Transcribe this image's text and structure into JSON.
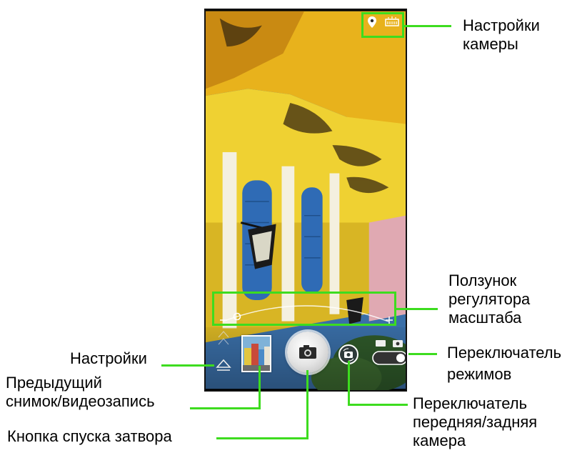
{
  "callouts": {
    "camera_settings": [
      "Настройки",
      "камеры"
    ],
    "zoom_slider": [
      "Ползунок",
      "регулятора",
      "масштаба"
    ],
    "mode_switch": [
      "Переключатель",
      "режимов"
    ],
    "settings": "Настройки",
    "previous_shot": [
      "Предыдущий",
      "снимок/видеозапись"
    ],
    "front_back_switch": [
      "Переключатель",
      "передняя/задняя",
      "камера"
    ],
    "shutter_button": "Кнопка спуска затвора"
  },
  "icons": {
    "location": "location-pin-icon",
    "flash": "flash-auto-icon",
    "settings": "settings-arrow-icon",
    "shutter": "camera-icon",
    "switch_camera": "switch-camera-icon",
    "mode_video": "video-camera-icon",
    "mode_photo": "photo-camera-icon"
  },
  "colors": {
    "callout_green": "#3ddc1f",
    "balcony_yellow": "#e9b21a",
    "wall_yellow": "#efd233",
    "shutter_blue": "#2f6bb5",
    "sky_blue": "#4a89c4"
  }
}
